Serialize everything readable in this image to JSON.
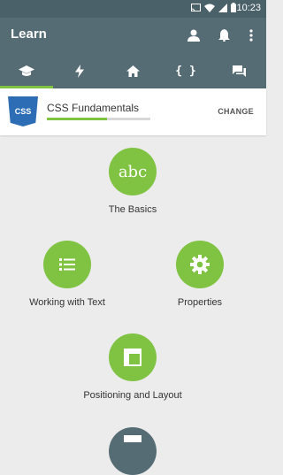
{
  "status_bar": {
    "time": "10:23",
    "icons": [
      "cast-icon",
      "wifi-icon",
      "signal-icon",
      "battery-icon"
    ]
  },
  "app_bar": {
    "title": "Learn",
    "actions": [
      "profile-icon",
      "notifications-icon",
      "more-icon"
    ]
  },
  "tabs": [
    {
      "icon": "graduation-cap-icon",
      "active": true
    },
    {
      "icon": "lightning-icon",
      "active": false
    },
    {
      "icon": "home-icon",
      "active": false
    },
    {
      "icon": "code-braces-icon",
      "active": false,
      "text": "{ }"
    },
    {
      "icon": "chat-icon",
      "active": false
    }
  ],
  "course": {
    "badge": "CSS",
    "title": "CSS Fundamentals",
    "progress": 0.58,
    "change_label": "CHANGE"
  },
  "lessons": [
    {
      "title": "The Basics",
      "icon_text": "abc"
    },
    {
      "title": "Working with Text",
      "icon": "list-icon"
    },
    {
      "title": "Properties",
      "icon": "gear-icon"
    },
    {
      "title": "Positioning and Layout",
      "icon": "layout-icon"
    }
  ],
  "colors": {
    "toolbar": "#556c74",
    "accent": "#80c342",
    "background": "#ececec"
  }
}
